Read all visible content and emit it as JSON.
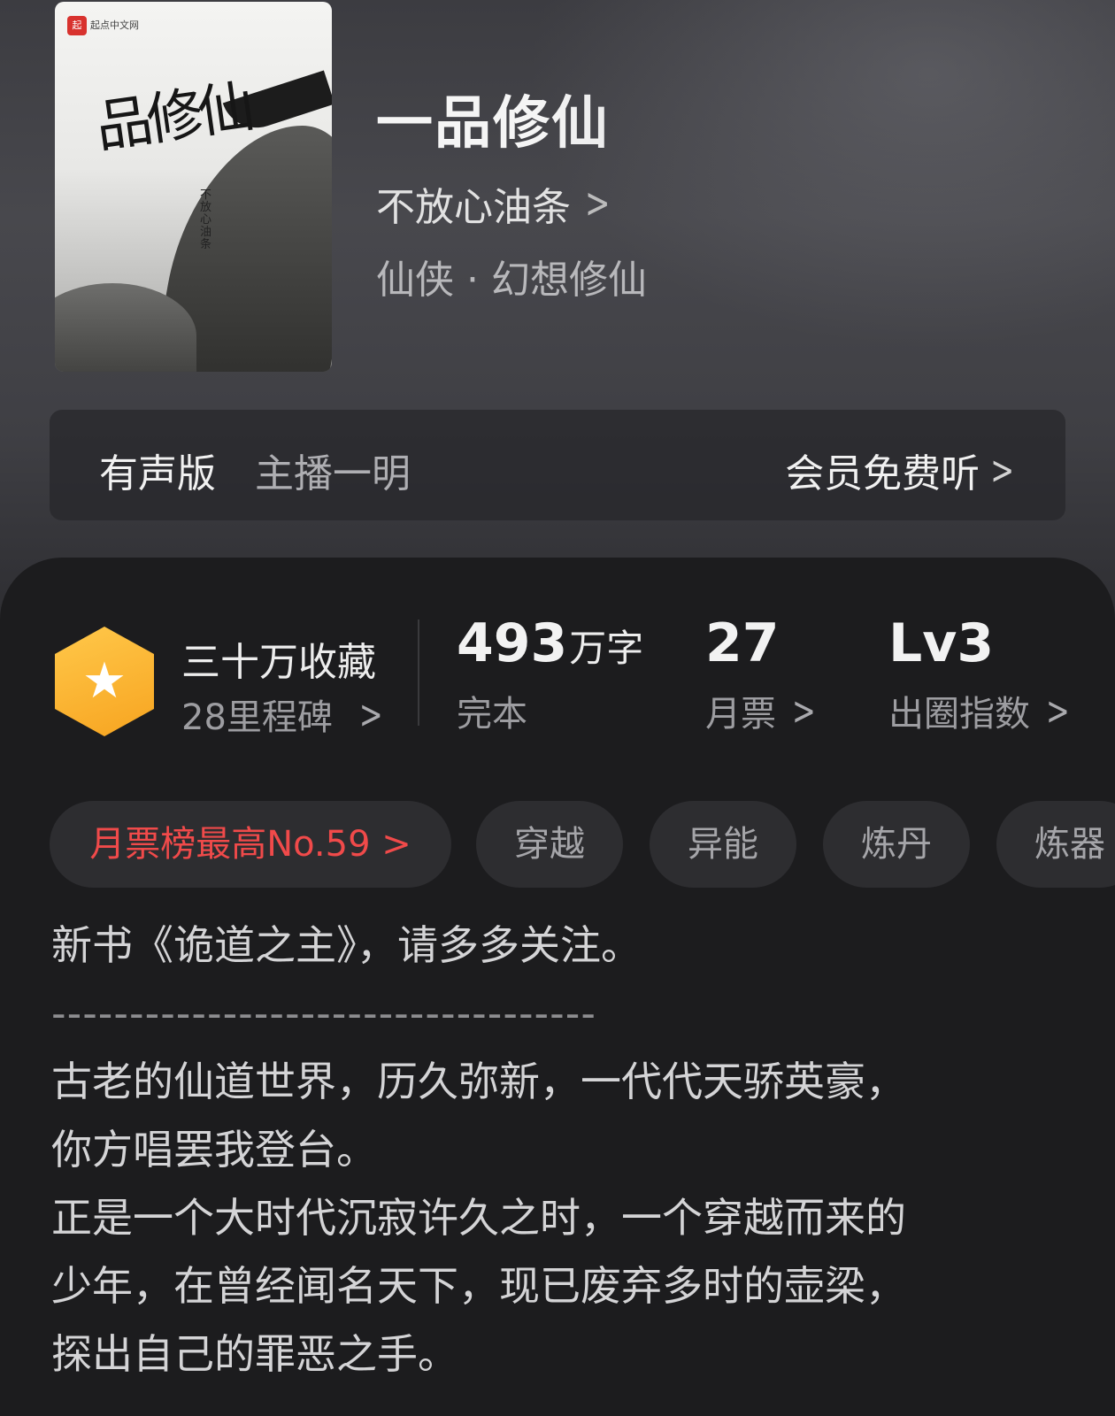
{
  "book": {
    "cover_publisher": "起点中文网",
    "cover_title_art": "品修仙",
    "cover_author_art": "不放心油条",
    "title": "一品修仙",
    "author": "不放心油条",
    "genre": "仙侠 · 幻想修仙"
  },
  "audio": {
    "label": "有声版",
    "host": "主播一明",
    "action": "会员免费听"
  },
  "stats": {
    "favorites": "三十万收藏",
    "milestones": "28里程碑",
    "words_num": "493",
    "words_unit": "万字",
    "status": "完本",
    "monthly_votes": "27",
    "monthly_label": "月票",
    "level": "Lv3",
    "level_label": "出圈指数"
  },
  "tags": {
    "rank": "月票榜最高No.59 >",
    "items": [
      "穿越",
      "异能",
      "炼丹",
      "炼器"
    ]
  },
  "description": {
    "line1": "新书《诡道之主》，请多多关注。",
    "separator": "-----------------------------------",
    "line2": "古老的仙道世界，历久弥新，一代代天骄英豪，",
    "line3": "你方唱罢我登台。",
    "line4": "正是一个大时代沉寂许久之时，一个穿越而来的",
    "line5": "少年，在曾经闻名天下，现已废弃多时的壶梁，",
    "line6": "探出自己的罪恶之手。"
  },
  "icons": {
    "favorites": "star-hexagon-icon",
    "chevron": "chevron-right-icon"
  },
  "colors": {
    "accent_orange": "#f7a420",
    "rank_red": "#f04a4a"
  }
}
